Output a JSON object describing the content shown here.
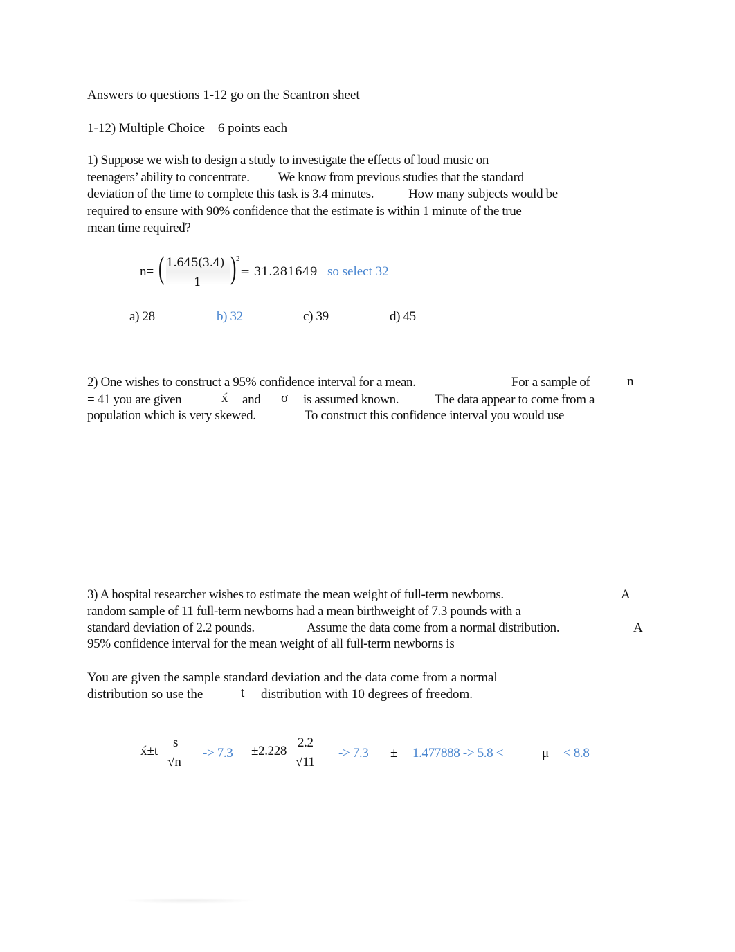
{
  "header": {
    "instructions": "Answers to questions 1-12 go on the Scantron sheet",
    "section_title": "1-12) Multiple Choice – 6 points each"
  },
  "questions": [
    {
      "number": "1",
      "lines": [
        "1) Suppose we wish to design a study to investigate the effects of loud music on",
        [
          "teenagers’ ability to concentrate.",
          "We know from previous studies that the standard"
        ],
        [
          "deviation of the time to complete this task is 3.4 minutes.",
          "How many subjects would be"
        ],
        "required to ensure with 90% confidence that the estimate is within 1 minute of the true",
        "mean time required?"
      ],
      "work": {
        "lhs": "n=",
        "numerator": "1.645(3.4)",
        "denominator": "1",
        "exponent": "2",
        "result": "= 31.281649",
        "note": "so select 32"
      },
      "choices": [
        {
          "label": "a) 28",
          "correct": false
        },
        {
          "label": "b) 32",
          "correct": true
        },
        {
          "label": "c) 39",
          "correct": false
        },
        {
          "label": "d) 45",
          "correct": false
        }
      ]
    },
    {
      "number": "2",
      "lines": [
        [
          "2) One wishes to construct a 95% confidence interval for a mean.",
          "For a sample of",
          "n"
        ],
        [
          "= 41 you are given",
          "ýx",
          "and",
          "σ",
          "is assumed known.",
          "The data appear to come from a"
        ],
        [
          "population which is very skewed.",
          "To construct this confidence interval you would use"
        ]
      ],
      "symbols": {
        "xbar": "x́",
        "sigma": "σ",
        "n": "n"
      }
    },
    {
      "number": "3",
      "lines": [
        [
          "3) A hospital researcher wishes to estimate the mean weight of full-term newborns.",
          "A"
        ],
        "random sample of 11 full-term newborns had a mean birthweight of 7.3 pounds with a",
        [
          "standard deviation of 2.2 pounds.",
          "Assume the data come from a normal distribution.",
          "A"
        ],
        "95% confidence interval for the mean weight of all full-term newborns is"
      ],
      "explanation": [
        "You are given the sample standard deviation and the data come from a normal",
        [
          "distribution so use the",
          "t",
          "distribution with 10 degrees of freedom."
        ]
      ],
      "work": {
        "formula_lhs": "x́±t",
        "formula_num": "s",
        "formula_den": "√n",
        "arrow1": "-> 7.3",
        "t_value": "±2.228",
        "num2": "2.2",
        "den2": "√11",
        "arrow2": "-> 7.3",
        "pm": "±",
        "margin": "1.477888 -> 5.8 <",
        "mu": "μ",
        "upper": "< 8.8"
      }
    }
  ],
  "colors": {
    "text": "#111111",
    "answer_blue": "#4a86d0"
  }
}
